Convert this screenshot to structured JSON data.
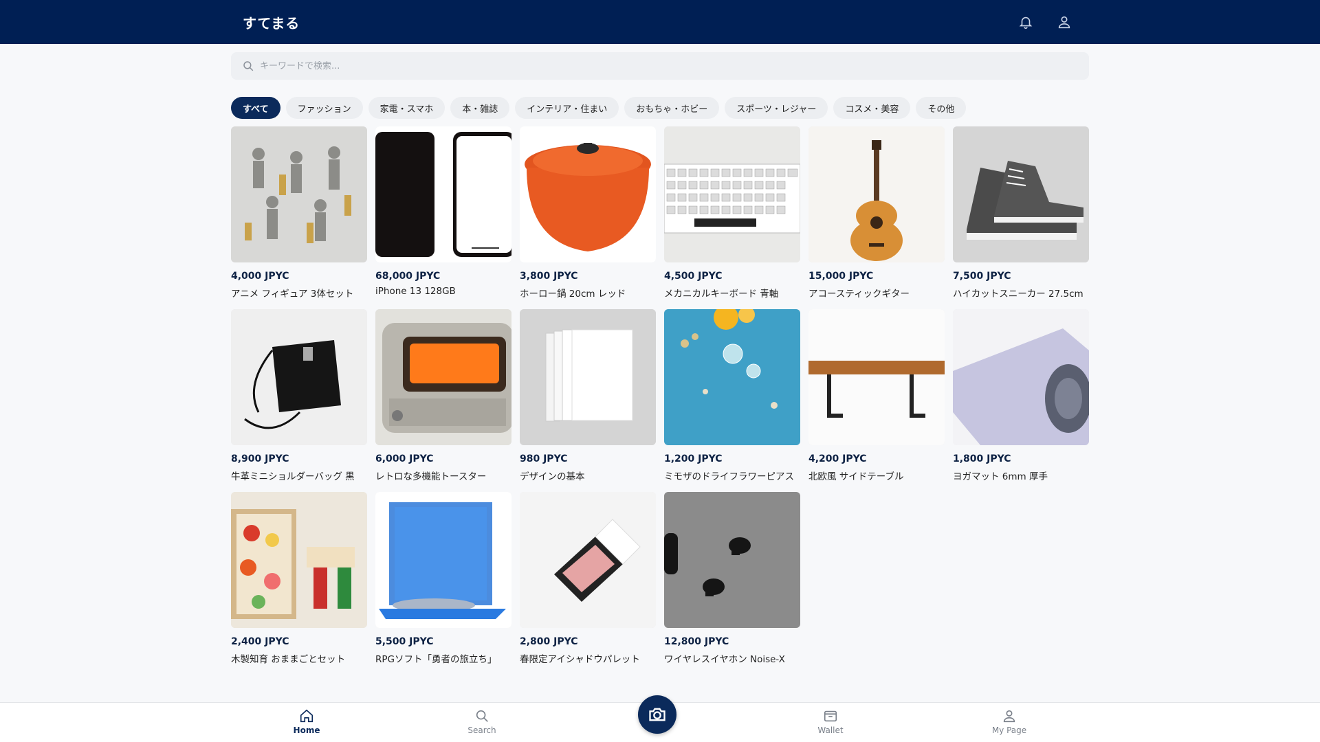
{
  "header": {
    "brand": "すてまる",
    "icons": [
      "bell-icon",
      "user-icon"
    ],
    "bg_color": "#001f54"
  },
  "search": {
    "placeholder": "キーワードで検索...",
    "value": ""
  },
  "categories": [
    {
      "label": "すべて",
      "active": true
    },
    {
      "label": "ファッション",
      "active": false
    },
    {
      "label": "家電・スマホ",
      "active": false
    },
    {
      "label": "本・雑誌",
      "active": false
    },
    {
      "label": "インテリア・住まい",
      "active": false
    },
    {
      "label": "おもちゃ・ホビー",
      "active": false
    },
    {
      "label": "スポーツ・レジャー",
      "active": false
    },
    {
      "label": "コスメ・美容",
      "active": false
    },
    {
      "label": "その他",
      "active": false
    }
  ],
  "products": [
    {
      "price": "4,000 JPYC",
      "title": "アニメ フィギュア 3体セット",
      "image": "metal-figures"
    },
    {
      "price": "68,000 JPYC",
      "title": "iPhone 13 128GB",
      "image": "smartphone"
    },
    {
      "price": "3,800 JPYC",
      "title": "ホーロー鍋 20cm レッド",
      "image": "enamel-pot"
    },
    {
      "price": "4,500 JPYC",
      "title": "メカニカルキーボード 青軸",
      "image": "keyboard"
    },
    {
      "price": "15,000 JPYC",
      "title": "アコースティックギター",
      "image": "guitar"
    },
    {
      "price": "7,500 JPYC",
      "title": "ハイカットスニーカー 27.5cm",
      "image": "sneakers"
    },
    {
      "price": "8,900 JPYC",
      "title": "牛革ミニショルダーバッグ 黒",
      "image": "shoulder-bag"
    },
    {
      "price": "6,000 JPYC",
      "title": "レトロな多機能トースター",
      "image": "toaster"
    },
    {
      "price": "980 JPYC",
      "title": "デザインの基本",
      "image": "white-books"
    },
    {
      "price": "1,200 JPYC",
      "title": "ミモザのドライフラワーピアス",
      "image": "earrings"
    },
    {
      "price": "4,200 JPYC",
      "title": "北欧風 サイドテーブル",
      "image": "side-table"
    },
    {
      "price": "1,800 JPYC",
      "title": "ヨガマット 6mm 厚手",
      "image": "yoga-mat"
    },
    {
      "price": "2,400 JPYC",
      "title": "木製知育 おままごとセット",
      "image": "wooden-toys"
    },
    {
      "price": "5,500 JPYC",
      "title": "RPGソフト「勇者の旅立ち」",
      "image": "game-case"
    },
    {
      "price": "2,800 JPYC",
      "title": "春限定アイシャドウパレット",
      "image": "eyeshadow"
    },
    {
      "price": "12,800 JPYC",
      "title": "ワイヤレスイヤホン Noise-X",
      "image": "earbuds"
    }
  ],
  "bottom_nav": {
    "items": [
      {
        "label": "Home",
        "icon": "home-icon",
        "active": true
      },
      {
        "label": "Search",
        "icon": "search-icon",
        "active": false
      },
      {
        "label": "Wallet",
        "icon": "wallet-icon",
        "active": false
      },
      {
        "label": "My Page",
        "icon": "user-icon",
        "active": false
      }
    ],
    "camera_icon": "camera-icon"
  }
}
